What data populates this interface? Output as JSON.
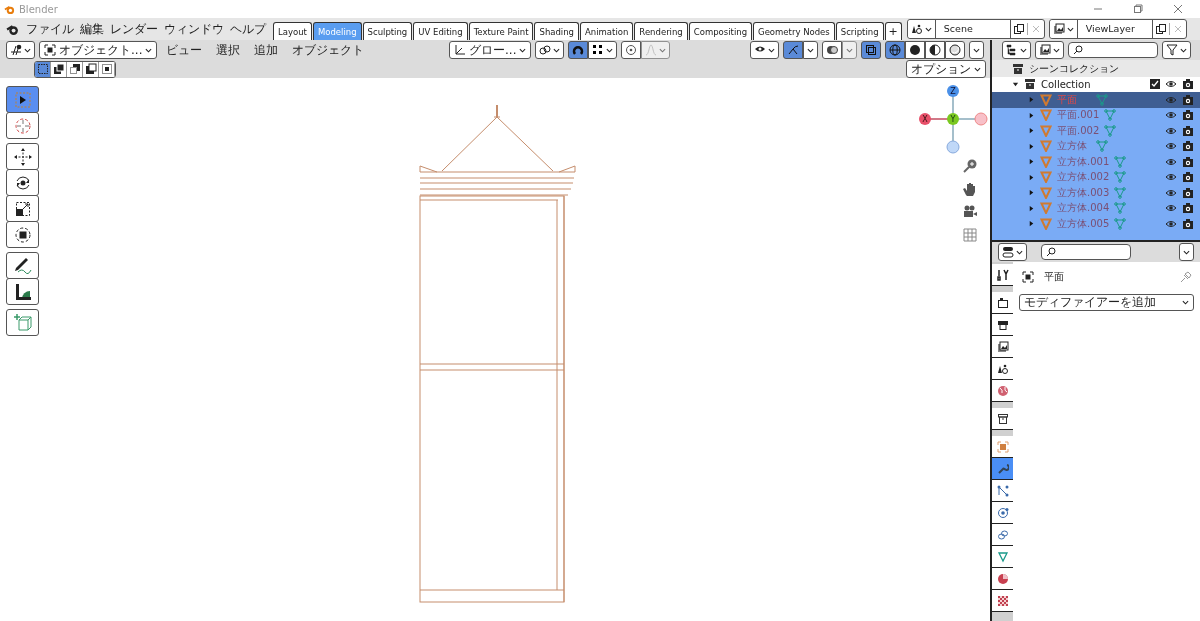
{
  "window": {
    "title": "Blender"
  },
  "menu": [
    "ファイル",
    "編集",
    "レンダー",
    "ウィンドウ",
    "ヘルプ"
  ],
  "workspaces": [
    {
      "label": "Layout",
      "selected": false
    },
    {
      "label": "Modeling",
      "selected": true
    },
    {
      "label": "Sculpting",
      "selected": false
    },
    {
      "label": "UV Editing",
      "selected": false
    },
    {
      "label": "Texture Paint",
      "selected": false
    },
    {
      "label": "Shading",
      "selected": false
    },
    {
      "label": "Animation",
      "selected": false
    },
    {
      "label": "Rendering",
      "selected": false
    },
    {
      "label": "Compositing",
      "selected": false
    },
    {
      "label": "Geometry Nodes",
      "selected": false
    },
    {
      "label": "Scripting",
      "selected": false
    }
  ],
  "add_workspace": "+",
  "scene": {
    "value": "Scene"
  },
  "view_layer": {
    "value": "ViewLayer"
  },
  "viewport_header": {
    "mode": "オブジェクト...",
    "menus": [
      "ビュー",
      "選択",
      "追加",
      "オブジェクト"
    ],
    "orientation": "グロー...",
    "snap": {
      "on": true
    },
    "gizmos": {
      "on": true
    },
    "xray": {
      "on": true
    },
    "shading": [
      {
        "kind": "wireframe",
        "selected": true
      },
      {
        "kind": "solid",
        "selected": false
      },
      {
        "kind": "material",
        "selected": false
      },
      {
        "kind": "rendered",
        "selected": false
      }
    ],
    "options": "オプション"
  },
  "select_modes": [
    {
      "selected": true
    },
    {
      "selected": false
    },
    {
      "selected": false
    },
    {
      "selected": false
    },
    {
      "selected": false
    }
  ],
  "tools": [
    {
      "kind": "select",
      "selected": true
    },
    {
      "kind": "cursor",
      "selected": false
    },
    {
      "kind": "move",
      "selected": false
    },
    {
      "kind": "rotate",
      "selected": false
    },
    {
      "kind": "scale",
      "selected": false
    },
    {
      "kind": "transform",
      "selected": false
    },
    {
      "kind": "annotate",
      "selected": false
    },
    {
      "kind": "measure",
      "selected": false
    },
    {
      "kind": "add-cube",
      "selected": false
    }
  ],
  "gizmo": {
    "x": "X",
    "y": "Y",
    "z": "Z"
  },
  "outliner": {
    "scene_collection": "シーンコレクション",
    "collection": {
      "name": "Collection",
      "checked": true,
      "expanded": true,
      "children": [
        {
          "name": "平面",
          "selected": true,
          "active": true
        },
        {
          "name": "平面.001",
          "selected": true,
          "active": false
        },
        {
          "name": "平面.002",
          "selected": true,
          "active": false
        },
        {
          "name": "立方体",
          "selected": true,
          "active": false
        },
        {
          "name": "立方体.001",
          "selected": true,
          "active": false
        },
        {
          "name": "立方体.002",
          "selected": true,
          "active": false
        },
        {
          "name": "立方体.003",
          "selected": true,
          "active": false
        },
        {
          "name": "立方体.004",
          "selected": true,
          "active": false
        },
        {
          "name": "立方体.005",
          "selected": true,
          "active": false
        }
      ]
    }
  },
  "properties": {
    "tab_groups": [
      [
        {
          "kind": "tool",
          "selected": false
        }
      ],
      [
        {
          "kind": "render",
          "selected": false
        },
        {
          "kind": "output",
          "selected": false
        },
        {
          "kind": "view-layer",
          "selected": false
        },
        {
          "kind": "scene",
          "selected": false
        },
        {
          "kind": "world",
          "selected": false
        }
      ],
      [
        {
          "kind": "collection",
          "selected": false
        }
      ],
      [
        {
          "kind": "object",
          "selected": false
        },
        {
          "kind": "modifier",
          "selected": true
        },
        {
          "kind": "particles",
          "selected": false
        },
        {
          "kind": "physics",
          "selected": false
        },
        {
          "kind": "constraints",
          "selected": false
        },
        {
          "kind": "data",
          "selected": false
        },
        {
          "kind": "material",
          "selected": false
        },
        {
          "kind": "texture",
          "selected": false
        }
      ]
    ],
    "object_name": "平面",
    "add_modifier": "モディファイアーを追加"
  }
}
